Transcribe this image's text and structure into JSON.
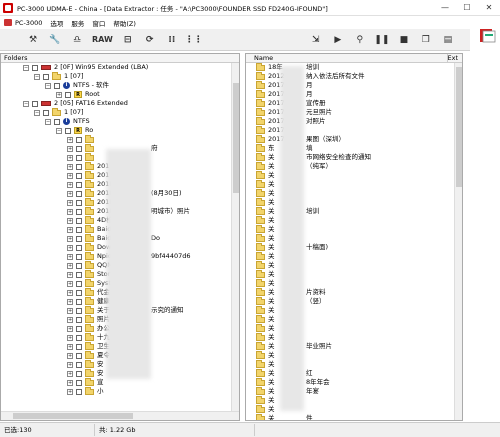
{
  "window": {
    "title": "PC-3000 UDMA-E - China - [Data Extractor : 任务 - \"A:\\PC3000\\FOUNDER SSD FD240G-IFOUND\"]",
    "minimize": "—",
    "maximize": "☐",
    "close": "✕"
  },
  "menu": [
    "PC-3000",
    "选项",
    "服务",
    "窗口",
    "帮助(Z)"
  ],
  "toolbar": {
    "raw_label": "RAW",
    "left_icons": [
      "tools-icon",
      "wrench-icon",
      "binoculars-icon",
      "raw-button",
      "chip-icon",
      "refresh-icon",
      "folders-icon",
      "branch-icon"
    ],
    "right_icons": [
      "export-icon",
      "play-icon",
      "bike-icon",
      "pause-icon",
      "stop-icon",
      "copy-icon",
      "log-icon"
    ]
  },
  "folders_pane": {
    "header": "Folders",
    "tree": [
      {
        "level": 0,
        "type": "disk",
        "label": "2 [0F] Win95 Extended (LBA)",
        "expander": "−"
      },
      {
        "level": 1,
        "type": "folder",
        "label": "1 [07]",
        "expander": "−"
      },
      {
        "level": 2,
        "type": "info",
        "label": "NTFS - 软件",
        "expander": "−"
      },
      {
        "level": 3,
        "type": "root",
        "label": "Root",
        "expander": "+"
      },
      {
        "level": 0,
        "type": "disk",
        "label": "2 [05] FAT16 Extended",
        "expander": "−"
      },
      {
        "level": 1,
        "type": "folder",
        "label": "1 [07]",
        "expander": "−"
      },
      {
        "level": 2,
        "type": "info",
        "label": "NTFS",
        "expander": "−"
      },
      {
        "level": 3,
        "type": "root",
        "label": "Ro",
        "expander": "−"
      },
      {
        "level": 4,
        "type": "folder",
        "label": "",
        "expander": "+"
      },
      {
        "level": 4,
        "type": "folder",
        "label": "",
        "expander": "+"
      },
      {
        "level": 4,
        "type": "folder",
        "label": "",
        "expander": "+"
      },
      {
        "level": 4,
        "type": "folder",
        "label": "201",
        "expander": "+"
      },
      {
        "level": 4,
        "type": "folder",
        "label": "201",
        "expander": "+"
      },
      {
        "level": 4,
        "type": "folder",
        "label": "2018",
        "expander": "+"
      },
      {
        "level": 4,
        "type": "folder",
        "label": "2018",
        "expander": "+"
      },
      {
        "level": 4,
        "type": "folder",
        "label": "2018",
        "expander": "+"
      },
      {
        "level": 4,
        "type": "folder",
        "label": "2018",
        "expander": "+"
      },
      {
        "level": 4,
        "type": "folder",
        "label": "4D检",
        "expander": "+"
      },
      {
        "level": 4,
        "type": "folder",
        "label": "BaiduN",
        "expander": "+"
      },
      {
        "level": 4,
        "type": "folder",
        "label": "BaiduN",
        "expander": "+"
      },
      {
        "level": 4,
        "type": "folder",
        "label": "Downl",
        "expander": "+"
      },
      {
        "level": 4,
        "type": "folder",
        "label": "Npio_",
        "expander": "+"
      },
      {
        "level": 4,
        "type": "folder",
        "label": "QQMu",
        "expander": "+"
      },
      {
        "level": 4,
        "type": "folder",
        "label": "Storm",
        "expander": "+"
      },
      {
        "level": 4,
        "type": "folder",
        "label": "Syste",
        "expander": "+"
      },
      {
        "level": 4,
        "type": "folder",
        "label": "代金",
        "expander": "+"
      },
      {
        "level": 4,
        "type": "folder",
        "label": "健康",
        "expander": "+"
      },
      {
        "level": 4,
        "type": "folder",
        "label": "关于",
        "expander": "+"
      },
      {
        "level": 4,
        "type": "folder",
        "label": "照片",
        "expander": "+"
      },
      {
        "level": 4,
        "type": "folder",
        "label": "办公",
        "expander": "+"
      },
      {
        "level": 4,
        "type": "folder",
        "label": "十九",
        "expander": "+"
      },
      {
        "level": 4,
        "type": "folder",
        "label": "卫生",
        "expander": "+"
      },
      {
        "level": 4,
        "type": "folder",
        "label": "夏令",
        "expander": "+"
      },
      {
        "level": 4,
        "type": "folder",
        "label": "安",
        "expander": "+"
      },
      {
        "level": 4,
        "type": "folder",
        "label": "安",
        "expander": "+"
      },
      {
        "level": 4,
        "type": "folder",
        "label": "宣",
        "expander": "+"
      },
      {
        "level": 4,
        "type": "folder",
        "label": "小",
        "expander": "+"
      }
    ],
    "tail_texts": [
      {
        "row": 9,
        "text": "府"
      },
      {
        "row": 14,
        "text": "(8月30日)"
      },
      {
        "row": 16,
        "text": "明城市）照片"
      },
      {
        "row": 19,
        "text": "Do"
      },
      {
        "row": 21,
        "text": "9bf44407d6"
      },
      {
        "row": 27,
        "text": "示究的通知"
      }
    ]
  },
  "files_pane": {
    "col_name": "Name",
    "col_ext": "Ext",
    "files": [
      "18年",
      "2012",
      "2017",
      "2017",
      "2017",
      "2017",
      "2017",
      "2017",
      "2017",
      "东",
      "关",
      "关",
      "关",
      "关",
      "关",
      "关",
      "关",
      "关",
      "关",
      "关",
      "关",
      "关",
      "关",
      "关",
      "关",
      "关",
      "关",
      "关",
      "关",
      "关",
      "关",
      "关",
      "关",
      "关",
      "关",
      "关",
      "关",
      "关",
      "关",
      "关"
    ],
    "tails": [
      {
        "row": 0,
        "text": "培训"
      },
      {
        "row": 1,
        "text": "纳入依法后所有文件"
      },
      {
        "row": 2,
        "text": "月"
      },
      {
        "row": 3,
        "text": "月"
      },
      {
        "row": 4,
        "text": "宣传册"
      },
      {
        "row": 5,
        "text": "元旦照片"
      },
      {
        "row": 6,
        "text": "对照片"
      },
      {
        "row": 8,
        "text": "果图（深圳）"
      },
      {
        "row": 9,
        "text": "填"
      },
      {
        "row": 10,
        "text": "市网络安全检查的通知"
      },
      {
        "row": 11,
        "text": "（纯军）"
      },
      {
        "row": 16,
        "text": "培训"
      },
      {
        "row": 20,
        "text": "十稿面)"
      },
      {
        "row": 25,
        "text": "片资料"
      },
      {
        "row": 26,
        "text": "（竖）"
      },
      {
        "row": 31,
        "text": "毕业照片"
      },
      {
        "row": 34,
        "text": "红"
      },
      {
        "row": 35,
        "text": "8年年会"
      },
      {
        "row": 36,
        "text": "年宴"
      },
      {
        "row": 39,
        "text": "件"
      }
    ]
  },
  "status": {
    "selected": "已选:130",
    "total": "共: 1.22 Gb"
  }
}
